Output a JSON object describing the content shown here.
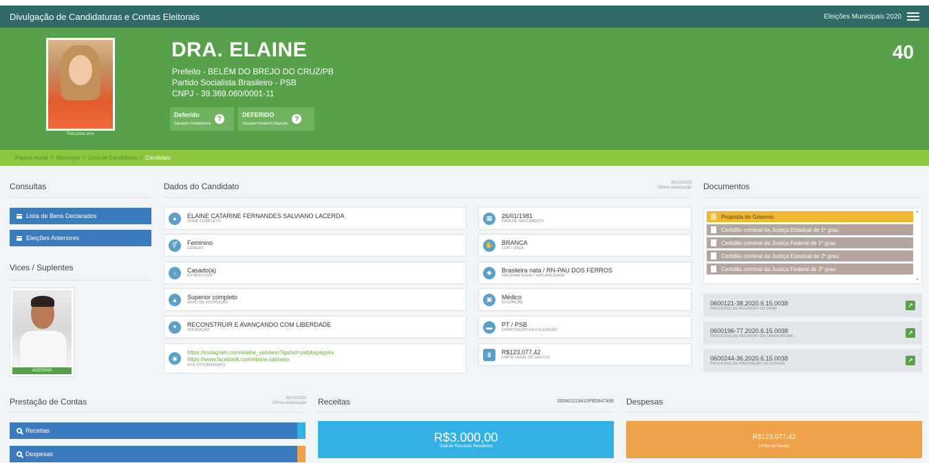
{
  "topbar": {
    "title": "Divulgação de Candidaturas e Contas Eleitorais",
    "election": "Eleições Municipais 2020"
  },
  "candidate": {
    "name": "DRA. ELAINE",
    "office": "Prefeito - BELÉM DO BREJO DO CRUZ/PB",
    "party": "Partido Socialista Brasileiro - PSB",
    "cnpj": "CNPJ - 39.369.060/0001-11",
    "number": "40",
    "photo_label": "Foto para urna",
    "status1": {
      "value": "Deferido",
      "label": "Situação Candidatura"
    },
    "status2": {
      "value": "DEFERIDO",
      "label": "Situação Partido/Coligação"
    }
  },
  "breadcrumb": [
    "Página Inicial",
    "Município",
    "Lista de Candidatos",
    "Candidato"
  ],
  "consultas": {
    "title": "Consultas",
    "buttons": [
      "Lista de Bens Declarados",
      "Eleições Anteriores"
    ]
  },
  "vices": {
    "title": "Vices / Suplentes",
    "action": "ACESSAR"
  },
  "dados": {
    "title": "Dados do Candidato",
    "updated": "26/10/2020",
    "updated_label": "Última atualização",
    "left": [
      {
        "value": "ELAINE CATARINE FERNANDES SALVIANO LACERDA",
        "label": "NOME COMPLETO"
      },
      {
        "value": "Feminino",
        "label": "GÊNERO"
      },
      {
        "value": "Casado(a)",
        "label": "ESTADO CIVIL"
      },
      {
        "value": "Superior completo",
        "label": "GRAU DE INSTRUÇÃO"
      },
      {
        "value": "RECONSTRUIR E AVANÇANDO COM LIBERDADE",
        "label": "COLIGAÇÃO"
      }
    ],
    "site": {
      "link1": "https://instagram.com/elaine_salviano?igshid=ywlybqyegxks",
      "link2": "https://www.facebook.com/elaine.salviano",
      "label": "SITE DO CANDIDATO"
    },
    "right": [
      {
        "value": "26/01/1981",
        "label": "DATA DE NASCIMENTO"
      },
      {
        "value": "BRANCA",
        "label": "COR / RAÇA"
      },
      {
        "value": "Brasileira nata / RN-PAU DOS FERROS",
        "label": "NACIONALIDADE / NATURALIDADE"
      },
      {
        "value": "Médico",
        "label": "OCUPAÇÃO"
      },
      {
        "value": "PT / PSB",
        "label": "COMPOSIÇÃO DA COLIGAÇÃO"
      },
      {
        "value": "R$123.077,42",
        "label": "LIMITE LEGAL DE GASTOS"
      }
    ]
  },
  "documentos": {
    "title": "Documentos",
    "items": [
      "Proposta de Governo",
      "Certidão criminal da Justiça Estadual de 1º grau",
      "Certidão criminal da Justiça Federal de 1º grau",
      "Certidão criminal da Justiça Estadual de 2º grau",
      "Certidão criminal da Justiça Federal de 2º grau"
    ],
    "processos": [
      {
        "value": "0600121-38.2020.6.15.0038",
        "label": "PROCESSO DE REGISTRO DO DRAP"
      },
      {
        "value": "0600196-77.2020.6.15.0038",
        "label": "PROCESSO DE REGISTRO DA CANDIDATURA"
      },
      {
        "value": "0600244-36.2020.6.15.0038",
        "label": "PROCESSO DE PRESTAÇÃO DE CONTAS"
      }
    ]
  },
  "prestacao": {
    "title": "Prestação de Contas",
    "updated": "26/10/2020",
    "updated_label": "Última atualização",
    "buttons": [
      "Receitas",
      "Despesas"
    ]
  },
  "receitas": {
    "title": "Receitas",
    "code": "000401119410PB5947496",
    "amount": "R$3.000,00",
    "label": "Total de Recursos Recebidos"
  },
  "despesas": {
    "title": "Despesas",
    "amount": "R$123.077,42",
    "label": "Limite de Gastos"
  },
  "colors": {
    "header": "#2e6b66",
    "hero": "#57a14b",
    "breadcrumb": "#8dc63f",
    "button": "#3a7bbf",
    "receitas": "#33b1e4",
    "despesas": "#f0a24a"
  }
}
